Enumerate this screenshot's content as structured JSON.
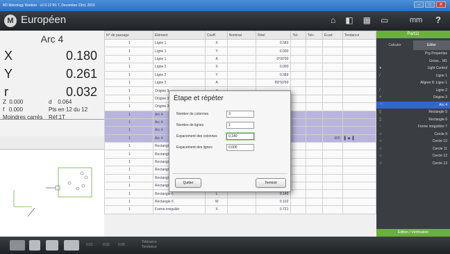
{
  "window": {
    "title": "M3 Metrology Reektor - v2.0.12 R1 T, December 23rd, 2015",
    "min": "–",
    "max": "□",
    "close": "✕"
  },
  "header": {
    "logo": "M",
    "brand": "Européen",
    "units": "mm",
    "help": "?",
    "icons": [
      "home-icon",
      "camera-icon",
      "grid-icon",
      "ruler-icon"
    ]
  },
  "readout": {
    "title": "Arc 4",
    "x_label": "X",
    "x_value": "0.180",
    "y_label": "Y",
    "y_value": "0.261",
    "r_label": "r",
    "r_value": "0.032",
    "z_label": "Z",
    "z_value": "0.000",
    "d_label": "d",
    "d_value": "0.064",
    "f_label": "f",
    "f_value": "0.000",
    "pts": "Pts en 12 du 12",
    "method": "Moindres carrés",
    "ref": "Réf.1T"
  },
  "table": {
    "headers": [
      "N° de passage",
      "Élément",
      "Coeff.",
      "Nominal",
      "Réel",
      "Tol-",
      "Tol+",
      "Écart",
      "Tendance"
    ],
    "rows": [
      [
        "1",
        "Ligne 1",
        "X",
        "",
        "0.583",
        "",
        "",
        "",
        ""
      ],
      [
        "1",
        "Ligne 1",
        "Y",
        "",
        "0.000",
        "",
        "",
        "",
        ""
      ],
      [
        "1",
        "Ligne 1",
        "A",
        "",
        "0°00'00",
        "",
        "",
        "",
        ""
      ],
      [
        "1",
        "Ligne 2",
        "X",
        "",
        "0.000",
        "",
        "",
        "",
        ""
      ],
      [
        "1",
        "Ligne 2",
        "Y",
        "",
        "0.389",
        "",
        "",
        "",
        ""
      ],
      [
        "1",
        "Ligne 2",
        "A",
        "",
        "89°59'60",
        "",
        "",
        "",
        ""
      ],
      [
        "1",
        "Origine 3",
        "X",
        "",
        "",
        "",
        "",
        "",
        ""
      ],
      [
        "1",
        "Origine 3",
        "Y",
        "",
        "",
        "",
        "",
        "",
        ""
      ],
      [
        "1",
        "Origine 3",
        "A",
        "",
        "",
        "",
        "",
        "",
        ""
      ],
      [
        "1",
        "Arc 4",
        "X",
        "",
        "",
        "",
        "",
        "",
        ""
      ],
      [
        "1",
        "Arc 4",
        "Y",
        "",
        "",
        "",
        "",
        "",
        ""
      ],
      [
        "1",
        "Arc 4",
        "r",
        "",
        "",
        "",
        "",
        "",
        ""
      ],
      [
        "1",
        "Arc 4",
        "d",
        "",
        "",
        "",
        "",
        "000",
        "▌ ◆ ▐"
      ],
      [
        "1",
        "Rectangle 5",
        "X",
        "",
        "",
        "",
        "",
        "",
        ""
      ],
      [
        "1",
        "Rectangle 5",
        "Y",
        "",
        "",
        "",
        "",
        "",
        ""
      ],
      [
        "1",
        "Rectangle 5",
        "L",
        "",
        "",
        "",
        "",
        "",
        ""
      ],
      [
        "1",
        "Rectangle 5",
        "W",
        "",
        "",
        "",
        "",
        "",
        ""
      ],
      [
        "1",
        "Rectangle 6",
        "X",
        "",
        "1.031",
        "",
        "",
        "",
        ""
      ],
      [
        "1",
        "Rectangle 6",
        "Y",
        "",
        "0.009",
        "",
        "",
        "",
        ""
      ],
      [
        "1",
        "Rectangle 6",
        "L",
        "",
        "0.145",
        "",
        "",
        "",
        ""
      ],
      [
        "1",
        "Rectangle 6",
        "W",
        "",
        "0.102",
        "",
        "",
        "",
        ""
      ],
      [
        "1",
        "Forme irrégulièr",
        "X",
        "",
        "0.721",
        "",
        "",
        "",
        ""
      ]
    ],
    "selected_rows": [
      9,
      10,
      11,
      12
    ]
  },
  "dialog": {
    "title": "Étape et répéter",
    "cols_label": "Nombre de colonnes",
    "cols_value": "3",
    "rows_label": "Nombre de lignes",
    "rows_value": "1",
    "colspace_label": "Espacement des colonnes",
    "colspace_value": "0.140",
    "rowspace_label": "Espacement des lignes",
    "rowspace_value": "0.000",
    "quit": "Quitter",
    "done": "Terminé"
  },
  "rightpanel": {
    "part": "Part11",
    "tab_calc": "Calculer",
    "tab_edit": "Éditer",
    "items": [
      {
        "label": "Prg Properties",
        "icon": ""
      },
      {
        "label": "Gross... M1",
        "icon": ""
      },
      {
        "label": "Light Control",
        "icon": "●"
      },
      {
        "label": "Ligne 1",
        "icon": "/"
      },
      {
        "label": "Aligner 8: Ligne 1",
        "icon": ""
      },
      {
        "label": "Ligne 2",
        "icon": "/"
      },
      {
        "label": "Origine 3",
        "icon": "+"
      },
      {
        "label": "Arc 4",
        "icon": "◠"
      },
      {
        "label": "Rectangle 5",
        "icon": "▯"
      },
      {
        "label": "Rectangle 6",
        "icon": "▯"
      },
      {
        "label": "Forme irrégulière 7",
        "icon": "◌"
      },
      {
        "label": "Cercle 9",
        "icon": "○"
      },
      {
        "label": "Cercle 10",
        "icon": "○"
      },
      {
        "label": "Cercle 11",
        "icon": "○"
      },
      {
        "label": "Cercle 12",
        "icon": "○"
      },
      {
        "label": "Cercle 13",
        "icon": "○"
      }
    ],
    "selected_index": 7,
    "footer": "Édition / Vérification"
  },
  "bottombar": {
    "vals": [
      "0.01",
      "0.02",
      "0.05"
    ],
    "tol_label": "Tolérance",
    "tol_sub": "Tendance"
  },
  "colors": {
    "accent_green": "#6bb03a",
    "selection_purple": "#b9b4dc",
    "selection_blue": "#3366cc"
  }
}
